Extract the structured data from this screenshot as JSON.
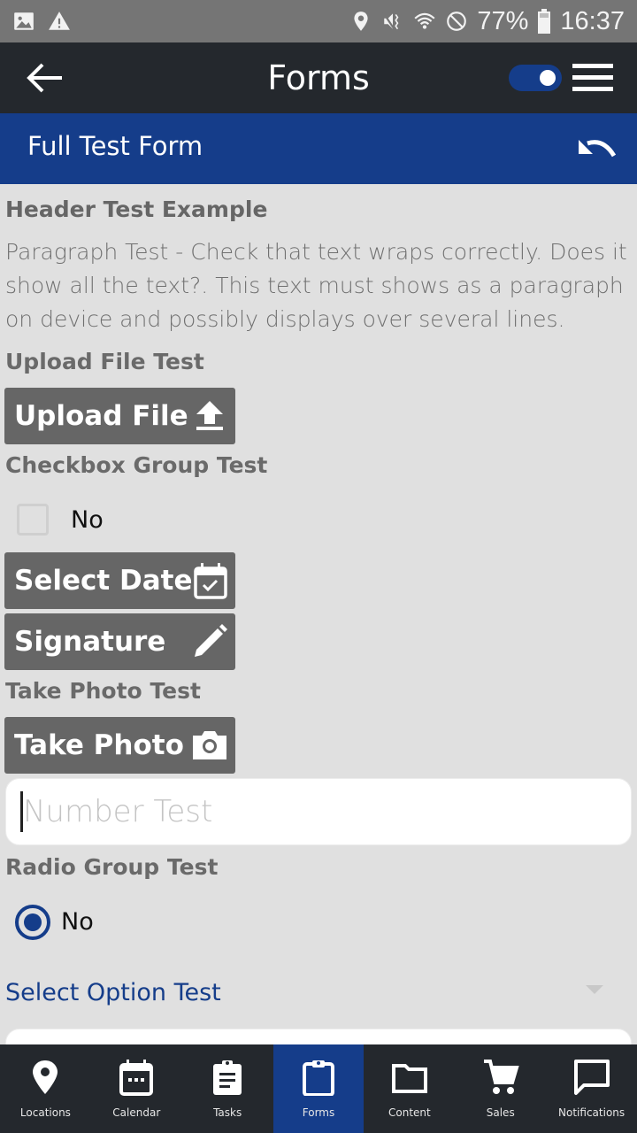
{
  "status_bar": {
    "left_icons": [
      "image-icon",
      "warning-icon"
    ],
    "right_icons": [
      "location-icon",
      "vibrate-mute-icon",
      "wifi-icon",
      "do-not-disturb-icon"
    ],
    "battery_percent": "77%",
    "time": "16:37"
  },
  "app_bar": {
    "title": "Forms",
    "toggle_on": true
  },
  "form_bar": {
    "title": "Full Test Form"
  },
  "form": {
    "header": "Header Test Example",
    "paragraph": "Paragraph Test - Check that text wraps correctly. Does it show all the text?. This text must shows as a paragraph on device and possibly displays over several lines.",
    "upload_label": "Upload File Test",
    "upload_button": "Upload File",
    "checkbox_label": "Checkbox Group Test",
    "checkbox_option": "No",
    "checkbox_checked": false,
    "date_button": "Select Date",
    "signature_button": "Signature",
    "photo_label": "Take Photo Test",
    "photo_button": "Take Photo",
    "number_placeholder": "Number Test",
    "number_value": "",
    "radio_label": "Radio Group Test",
    "radio_option": "No",
    "radio_selected": true,
    "select_label": "Select Option Test"
  },
  "colors": {
    "brand_blue": "#153d8a",
    "dark_bar": "#24282d",
    "button_gray": "#666666"
  },
  "bottom_nav": {
    "items": [
      {
        "label": "Locations",
        "icon": "location-pin-icon",
        "active": false
      },
      {
        "label": "Calendar",
        "icon": "calendar-icon",
        "active": false
      },
      {
        "label": "Tasks",
        "icon": "clipboard-list-icon",
        "active": false
      },
      {
        "label": "Forms",
        "icon": "clipboard-icon",
        "active": true
      },
      {
        "label": "Content",
        "icon": "folder-icon",
        "active": false
      },
      {
        "label": "Sales",
        "icon": "cart-icon",
        "active": false
      },
      {
        "label": "Notifications",
        "icon": "chat-bubble-icon",
        "active": false
      }
    ]
  }
}
